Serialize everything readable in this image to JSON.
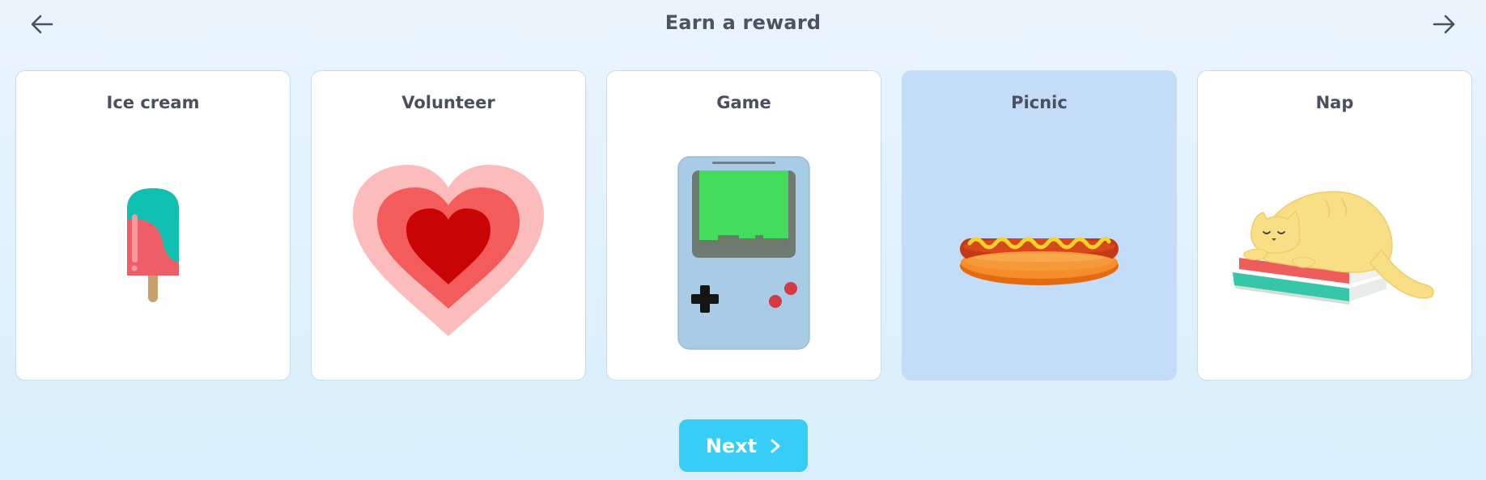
{
  "header": {
    "title": "Earn a reward",
    "back_icon": "arrow-left-icon",
    "forward_icon": "arrow-right-icon"
  },
  "rewards": [
    {
      "label": "Ice cream",
      "icon": "popsicle-icon",
      "selected": false
    },
    {
      "label": "Volunteer",
      "icon": "heart-icon",
      "selected": false
    },
    {
      "label": "Game",
      "icon": "handheld-game-icon",
      "selected": false
    },
    {
      "label": "Picnic",
      "icon": "hotdog-icon",
      "selected": true
    },
    {
      "label": "Nap",
      "icon": "sleeping-cat-icon",
      "selected": false
    }
  ],
  "footer": {
    "next_label": "Next",
    "next_icon": "chevron-right-icon"
  },
  "colors": {
    "selected_card": "#c3dcf7",
    "next_button": "#37cdf7",
    "text": "#4a5060"
  }
}
